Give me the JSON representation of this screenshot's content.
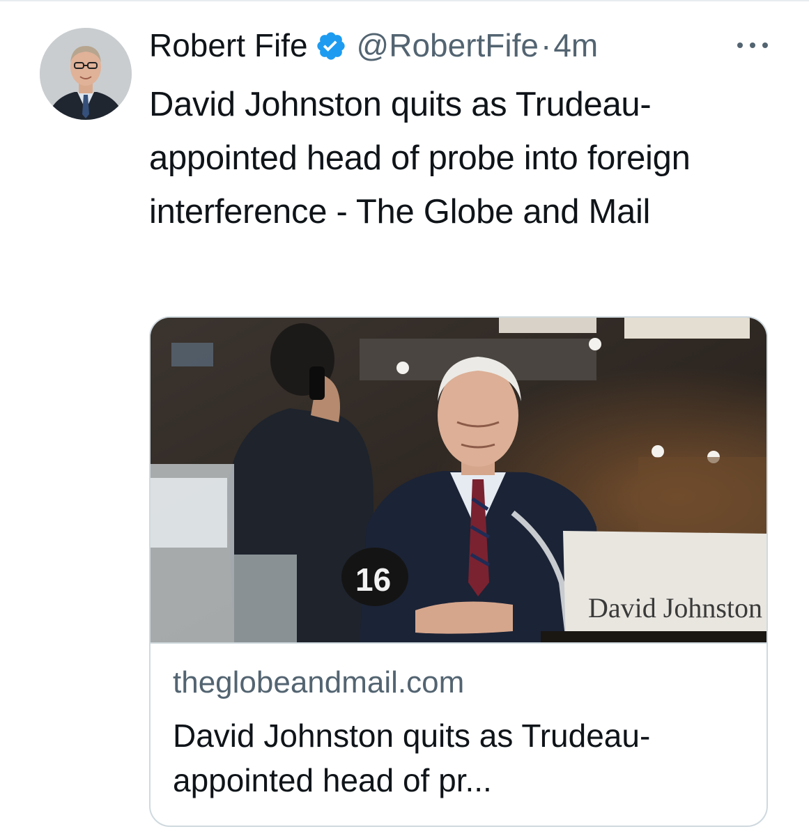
{
  "tweet": {
    "author": {
      "display_name": "Robert Fife",
      "handle": "@RobertFife",
      "verified": true,
      "avatar_icon": "user-avatar-photo"
    },
    "separator": "·",
    "timestamp": "4m",
    "more_icon": "more-horizontal-icon",
    "text": "David Johnston quits as Trudeau-appointed head of probe into foreign interference - The Globe and Mail",
    "card": {
      "image_alt": "David Johnston at committee hearing",
      "image_placard_number": "16",
      "image_nameplate_text": "David Johnston",
      "domain": "theglobeandmail.com",
      "title": "David Johnston quits as Trudeau-appointed head of pr..."
    }
  },
  "colors": {
    "text_primary": "#0f1419",
    "text_secondary": "#536471",
    "verified_blue": "#1d9bf0",
    "border": "#cfd9de"
  }
}
